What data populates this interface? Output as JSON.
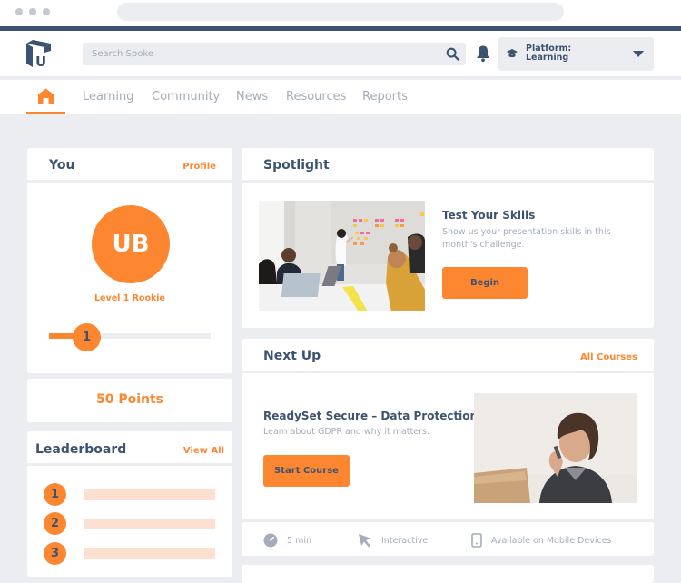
{
  "browser": {
    "dots": 3
  },
  "header": {
    "logo_letter": "U",
    "search": {
      "placeholder": "Search Spoke",
      "value": ""
    },
    "platform": {
      "label_line1": "Platform:",
      "label_line2": "Learning"
    }
  },
  "nav": {
    "home_icon": "home-icon",
    "tabs": [
      "Learning",
      "Community",
      "News",
      "Resources",
      "Reports"
    ],
    "active": "home"
  },
  "you": {
    "title": "You",
    "profile_link": "Profile",
    "initials": "UB",
    "level_label": "Level 1 Rookie",
    "level_value": "1",
    "level_progress_fraction": 0.23
  },
  "points": {
    "label": "50 Points"
  },
  "leaderboard": {
    "title": "Leaderboard",
    "view_all": "View All",
    "ranks": [
      "1",
      "2",
      "3"
    ]
  },
  "spotlight": {
    "title": "Spotlight",
    "item_title": "Test Your Skills",
    "item_desc": "Show us your presentation skills in this month's challenge.",
    "button": "Begin"
  },
  "next_up": {
    "title": "Next Up",
    "all_courses": "All Courses",
    "course_title": "ReadySet Secure – Data Protection",
    "course_desc": "Learn about GDPR and why it matters.",
    "button": "Start Course",
    "meta": {
      "duration": "5 min",
      "type": "Interactive",
      "availability": "Available on Mobile Devices"
    }
  },
  "colors": {
    "accent": "#fd8731",
    "navy": "#3d5372",
    "muted": "#a4adb9",
    "background": "#ebedf0"
  }
}
